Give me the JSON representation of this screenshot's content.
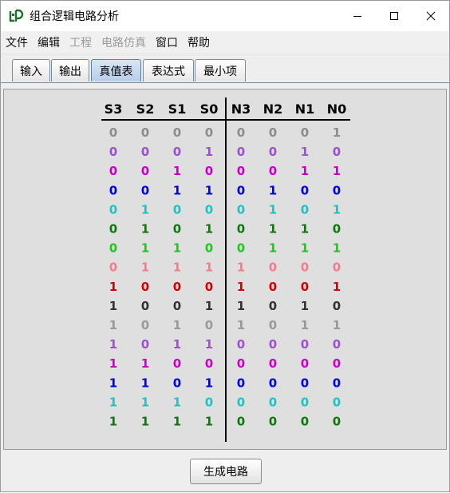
{
  "window": {
    "title": "组合逻辑电路分析"
  },
  "menu": [
    {
      "label": "文件",
      "enabled": true
    },
    {
      "label": "编辑",
      "enabled": true
    },
    {
      "label": "工程",
      "enabled": false
    },
    {
      "label": "电路仿真",
      "enabled": false
    },
    {
      "label": "窗口",
      "enabled": true
    },
    {
      "label": "帮助",
      "enabled": true
    }
  ],
  "tabs": [
    {
      "label": "输入",
      "active": false
    },
    {
      "label": "输出",
      "active": false
    },
    {
      "label": "真值表",
      "active": true
    },
    {
      "label": "表达式",
      "active": false
    },
    {
      "label": "最小项",
      "active": false
    }
  ],
  "truth_table": {
    "input_headers": [
      "S3",
      "S2",
      "S1",
      "S0"
    ],
    "output_headers": [
      "N3",
      "N2",
      "N1",
      "N0"
    ],
    "rows": [
      {
        "color": "#8c8c8c",
        "inputs": [
          "0",
          "0",
          "0",
          "0"
        ],
        "outputs": [
          "0",
          "0",
          "0",
          "1"
        ]
      },
      {
        "color": "#a04fd0",
        "inputs": [
          "0",
          "0",
          "0",
          "1"
        ],
        "outputs": [
          "0",
          "0",
          "1",
          "0"
        ]
      },
      {
        "color": "#c800c8",
        "inputs": [
          "0",
          "0",
          "1",
          "0"
        ],
        "outputs": [
          "0",
          "0",
          "1",
          "1"
        ]
      },
      {
        "color": "#0000e6",
        "inputs": [
          "0",
          "0",
          "1",
          "1"
        ],
        "outputs": [
          "0",
          "1",
          "0",
          "0"
        ]
      },
      {
        "color": "#1ec3c3",
        "inputs": [
          "0",
          "1",
          "0",
          "0"
        ],
        "outputs": [
          "0",
          "1",
          "0",
          "1"
        ]
      },
      {
        "color": "#0a7a0a",
        "inputs": [
          "0",
          "1",
          "0",
          "1"
        ],
        "outputs": [
          "0",
          "1",
          "1",
          "0"
        ]
      },
      {
        "color": "#1ec81e",
        "inputs": [
          "0",
          "1",
          "1",
          "0"
        ],
        "outputs": [
          "0",
          "1",
          "1",
          "1"
        ]
      },
      {
        "color": "#f07e8c",
        "inputs": [
          "0",
          "1",
          "1",
          "1"
        ],
        "outputs": [
          "1",
          "0",
          "0",
          "0"
        ]
      },
      {
        "color": "#d20000",
        "inputs": [
          "1",
          "0",
          "0",
          "0"
        ],
        "outputs": [
          "1",
          "0",
          "0",
          "1"
        ]
      },
      {
        "color": "#333333",
        "inputs": [
          "1",
          "0",
          "0",
          "1"
        ],
        "outputs": [
          "1",
          "0",
          "1",
          "0"
        ]
      },
      {
        "color": "#9a9a9a",
        "inputs": [
          "1",
          "0",
          "1",
          "0"
        ],
        "outputs": [
          "1",
          "0",
          "1",
          "1"
        ]
      },
      {
        "color": "#a04fd0",
        "inputs": [
          "1",
          "0",
          "1",
          "1"
        ],
        "outputs": [
          "0",
          "0",
          "0",
          "0"
        ]
      },
      {
        "color": "#c800c8",
        "inputs": [
          "1",
          "1",
          "0",
          "0"
        ],
        "outputs": [
          "0",
          "0",
          "0",
          "0"
        ]
      },
      {
        "color": "#0000e6",
        "inputs": [
          "1",
          "1",
          "0",
          "1"
        ],
        "outputs": [
          "0",
          "0",
          "0",
          "0"
        ]
      },
      {
        "color": "#1ec3c3",
        "inputs": [
          "1",
          "1",
          "1",
          "0"
        ],
        "outputs": [
          "0",
          "0",
          "0",
          "0"
        ]
      },
      {
        "color": "#0a7a0a",
        "inputs": [
          "1",
          "1",
          "1",
          "1"
        ],
        "outputs": [
          "0",
          "0",
          "0",
          "0"
        ]
      }
    ]
  },
  "actions": {
    "generate_label": "生成电路"
  }
}
